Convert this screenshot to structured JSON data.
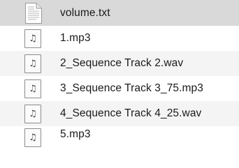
{
  "file_list": {
    "items": [
      {
        "name": "volume.txt",
        "icon": "text-document-icon",
        "selected": true
      },
      {
        "name": "1.mp3",
        "icon": "audio-file-icon",
        "glyph": "♫"
      },
      {
        "name": "2_Sequence Track 2.wav",
        "icon": "audio-file-icon",
        "glyph": "♫"
      },
      {
        "name": "3_Sequence Track 3_75.mp3",
        "icon": "audio-file-icon",
        "glyph": "♫"
      },
      {
        "name": "4_Sequence Track 4_25.wav",
        "icon": "audio-file-icon",
        "glyph": "♫"
      },
      {
        "name": "5.mp3",
        "icon": "audio-file-icon",
        "glyph": "♫"
      }
    ]
  },
  "colors": {
    "selected_row": "#d9d9d9",
    "alternate_row": "#f4f4f4",
    "text": "#1a1a1a"
  }
}
